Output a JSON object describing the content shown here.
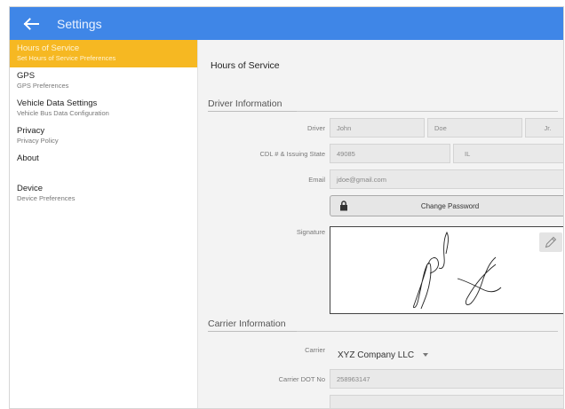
{
  "appbar": {
    "title": "Settings"
  },
  "sidebar": {
    "items": [
      {
        "title": "Hours of Service",
        "subtitle": "Set Hours of Service Preferences"
      },
      {
        "title": "GPS",
        "subtitle": "GPS Preferences"
      },
      {
        "title": "Vehicle Data Settings",
        "subtitle": "Vehicle Bus Data Configuration"
      },
      {
        "title": "Privacy",
        "subtitle": "Privacy Policy"
      },
      {
        "title": "About",
        "subtitle": ""
      },
      {
        "title": "Device",
        "subtitle": "Device Preferences"
      }
    ]
  },
  "main": {
    "title": "Hours of Service",
    "driver": {
      "section_title": "Driver Information",
      "driver_label": "Driver",
      "first_name": "John",
      "last_name": "Doe",
      "suffix": "Jr.",
      "cdl_label": "CDL # & Issuing State",
      "cdl_number": "49085",
      "cdl_state": "IL",
      "email_label": "Email",
      "email": "jdoe@gmail.com",
      "change_password_label": "Change Password",
      "signature_label": "Signature"
    },
    "carrier": {
      "section_title": "Carrier Information",
      "carrier_label": "Carrier",
      "carrier_value": "XYZ Company LLC",
      "dot_label": "Carrier DOT No",
      "dot_value": "258963147"
    }
  },
  "colors": {
    "appbar": "#3f86e7",
    "active_item": "#f6b822"
  },
  "icons": {
    "back": "arrow-left-icon",
    "lock": "lock-icon",
    "edit": "pencil-icon",
    "dropdown": "caret-down-icon"
  }
}
